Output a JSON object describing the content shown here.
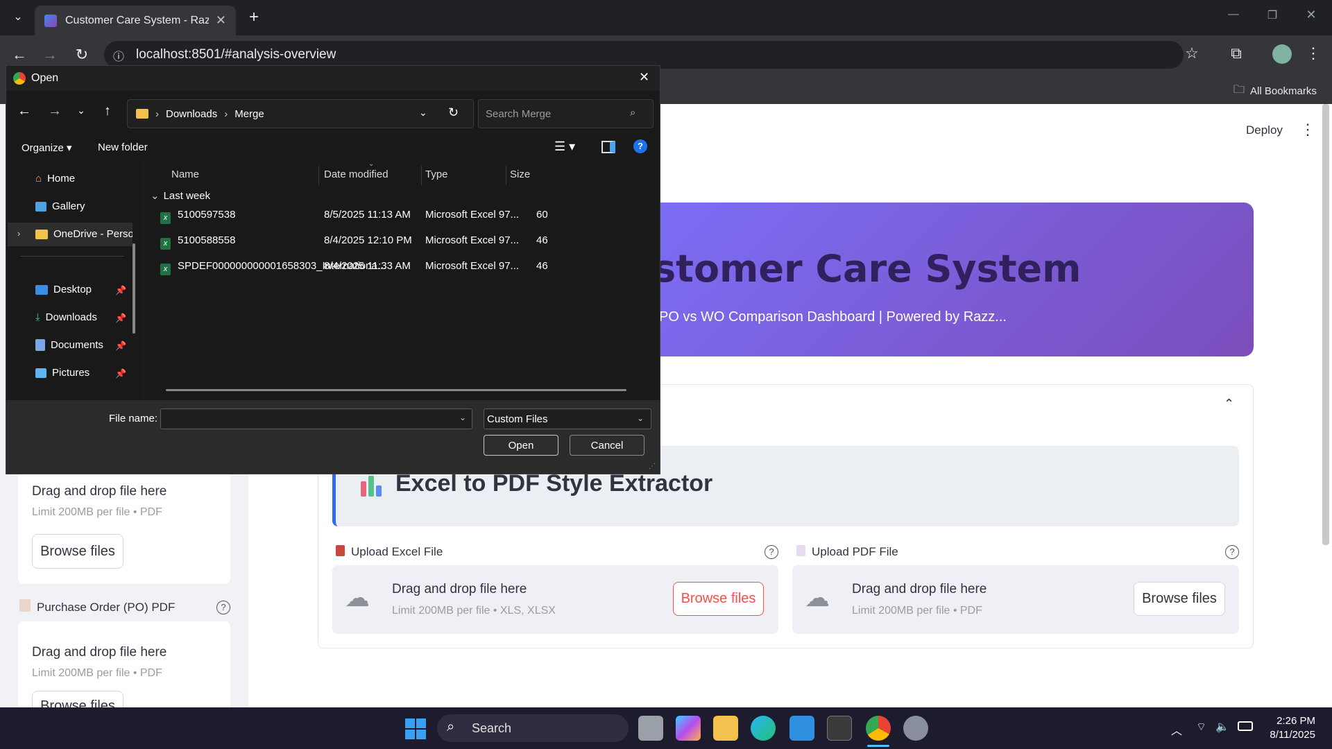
{
  "browser": {
    "tab_title": "Customer Care System - Razz S",
    "url": "localhost:8501/#analysis-overview",
    "bookmarks_label": "All Bookmarks"
  },
  "app": {
    "deploy": "Deploy",
    "hero_title": "stomer Care System",
    "hero_subtitle": "PO vs WO Comparison Dashboard | Powered by Razz...",
    "extractor_title": "Excel to PDF Style Extractor",
    "excel_upload_label": "Upload Excel File",
    "pdf_upload_label": "Upload PDF File",
    "drag_text": "Drag and drop file here",
    "limit_xls": "Limit 200MB per file • XLS, XLSX",
    "limit_pdf": "Limit 200MB per file • PDF",
    "browse": "Browse files",
    "po_label": "Purchase Order (PO) PDF"
  },
  "dialog": {
    "title": "Open",
    "path": [
      "Downloads",
      "Merge"
    ],
    "search_placeholder": "Search Merge",
    "organize": "Organize",
    "new_folder": "New folder",
    "nav": [
      "Home",
      "Gallery",
      "OneDrive - Perso",
      "Desktop",
      "Downloads",
      "Documents",
      "Pictures"
    ],
    "columns": [
      "Name",
      "Date modified",
      "Type",
      "Size"
    ],
    "group": "Last week",
    "files": [
      {
        "name": "5100597538",
        "date": "8/5/2025 11:13 AM",
        "type": "Microsoft Excel 97...",
        "size": "60"
      },
      {
        "name": "5100588558",
        "date": "8/4/2025 12:10 PM",
        "type": "Microsoft Excel 97...",
        "size": "46"
      },
      {
        "name": "SPDEF000000000001658303_Internationa...",
        "date": "8/4/2025 11:33 AM",
        "type": "Microsoft Excel 97...",
        "size": "46"
      }
    ],
    "file_name_label": "File name:",
    "file_type": "Custom Files",
    "open": "Open",
    "cancel": "Cancel"
  },
  "taskbar": {
    "search": "Search",
    "time": "2:26 PM",
    "date": "8/11/2025"
  }
}
